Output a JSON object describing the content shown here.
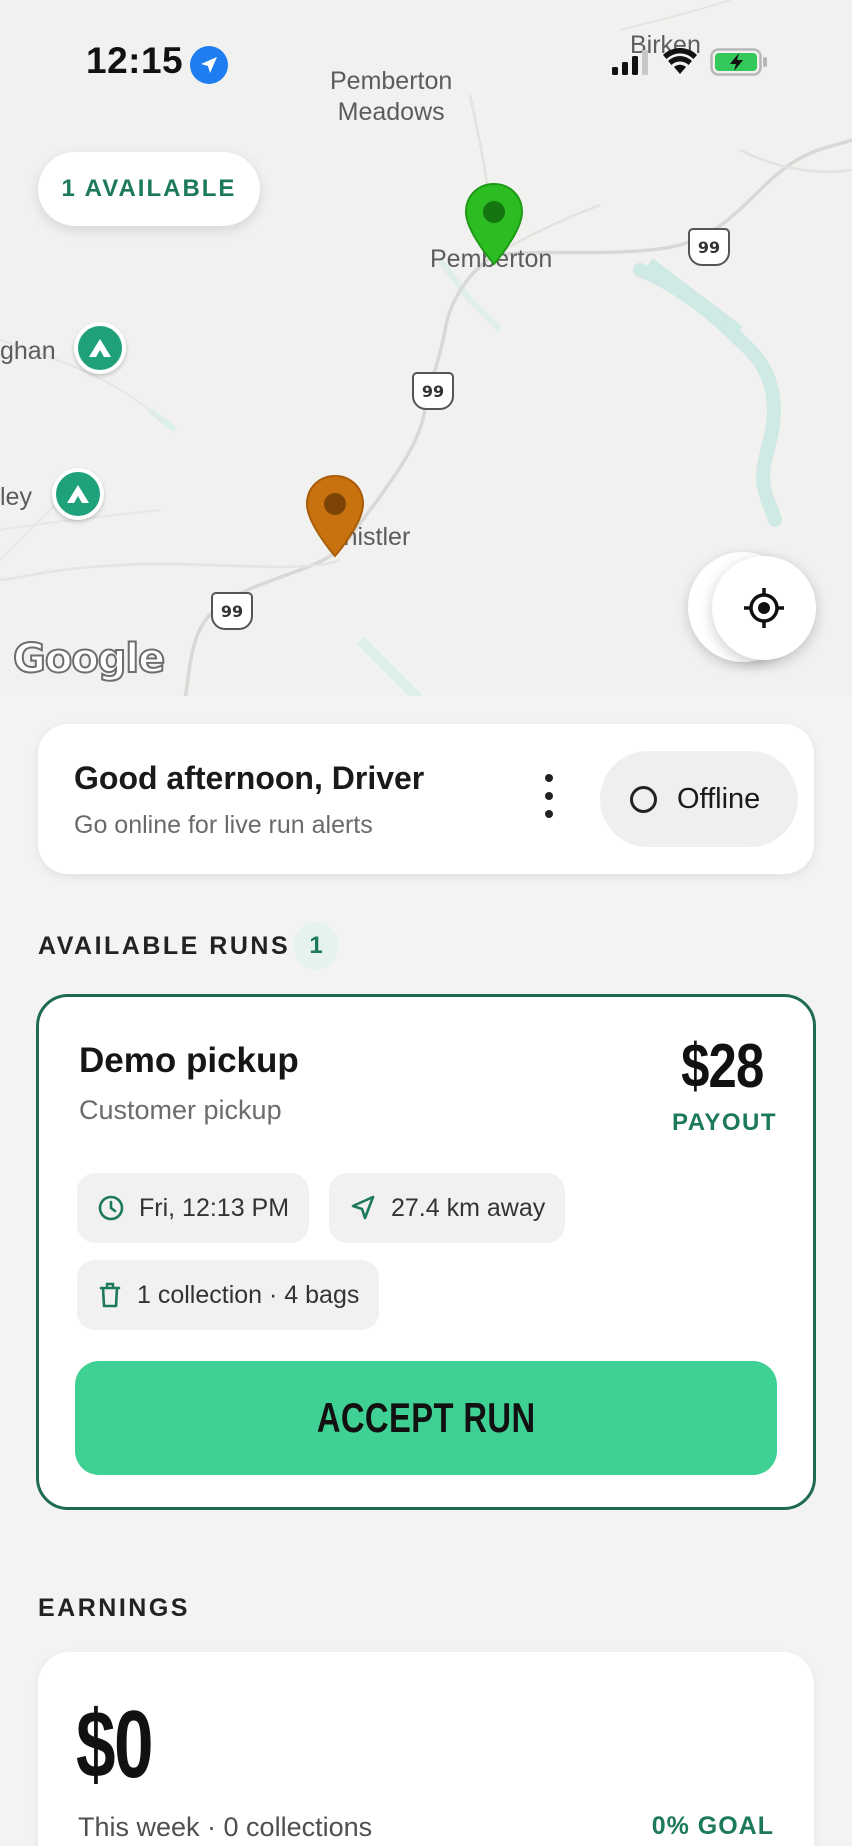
{
  "status_bar": {
    "time": "12:15",
    "location_icon": "location-arrow-icon",
    "signal_icon": "cellular-signal-icon",
    "wifi_icon": "wifi-icon",
    "battery_icon": "battery-charging-icon"
  },
  "map": {
    "labels": {
      "pemberton_meadows": "Pemberton\nMeadows",
      "birken": "Birken",
      "pemberton": "Pemberton",
      "whistler": "Whistler",
      "callaghan": "ghan",
      "valley": "ley"
    },
    "highway_shields": [
      "99",
      "99",
      "99"
    ],
    "available_pill": "1 AVAILABLE",
    "attribution": "Google",
    "colors": {
      "pin_green": "#2bbd22",
      "pin_orange": "#c8710f",
      "park_green": "#1fa27b",
      "water": "#cfe9e4"
    }
  },
  "greeting": {
    "title": "Good afternoon, Driver",
    "subtitle": "Go online for live run alerts",
    "status_label": "Offline"
  },
  "available_runs": {
    "heading": "AVAILABLE RUNS",
    "count": "1",
    "runs": [
      {
        "title": "Demo pickup",
        "subtitle": "Customer pickup",
        "price": "$28",
        "price_label": "PAYOUT",
        "time": "Fri, 12:13 PM",
        "distance": "27.4 km away",
        "details": "1 collection · 4 bags",
        "action": "ACCEPT RUN"
      }
    ]
  },
  "earnings": {
    "heading": "EARNINGS",
    "value": "$0",
    "subtitle": "This week · 0 collections",
    "goal": "0% GOAL"
  },
  "colors": {
    "accent_green": "#1c7a58",
    "accept_button": "#3fd193",
    "card_border": "#1f6b4f"
  }
}
